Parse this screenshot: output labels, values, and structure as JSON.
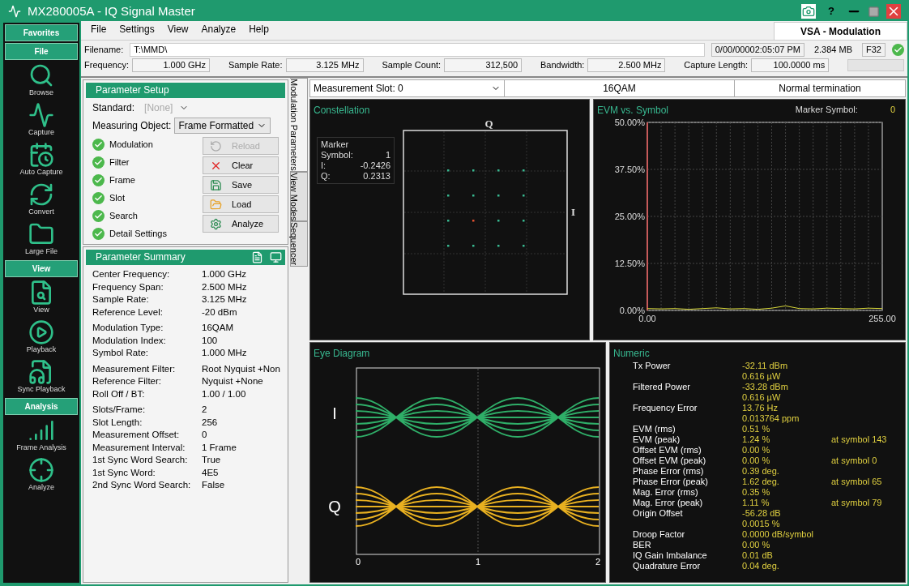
{
  "window": {
    "title": "MX280005A - IQ Signal Master",
    "help_button": "?"
  },
  "sidebar": {
    "sections": [
      {
        "header": "Favorites"
      },
      {
        "header": "File",
        "items": [
          "Browse",
          "Capture",
          "Auto Capture",
          "Convert",
          "Large File"
        ]
      },
      {
        "header": "View",
        "items": [
          "View",
          "Playback",
          "Sync Playback"
        ]
      },
      {
        "header": "Analysis",
        "items": [
          "Frame Analysis",
          "Analyze"
        ]
      }
    ]
  },
  "menu": [
    "File",
    "Settings",
    "View",
    "Analyze",
    "Help"
  ],
  "mode_tab": "VSA - Modulation",
  "info": {
    "filename_label": "Filename:",
    "filename": "T:\\MMD\\",
    "timestamp": "0/00/00002:05:07 PM",
    "size": "2.384 MB",
    "format": "F32",
    "fields": [
      {
        "label": "Frequency:",
        "value": "1.000 GHz"
      },
      {
        "label": "Sample Rate:",
        "value": "3.125 MHz"
      },
      {
        "label": "Sample Count:",
        "value": "312,500"
      },
      {
        "label": "Bandwidth:",
        "value": "2.500 MHz"
      },
      {
        "label": "Capture Length:",
        "value": "100.0000 ms"
      }
    ]
  },
  "parameter_setup": {
    "title": "Parameter Setup",
    "standard_label": "Standard:",
    "standard_value": "[None]",
    "standard_disabled": true,
    "object_label": "Measuring Object:",
    "object_value": "Frame Formatted",
    "checklist": [
      {
        "label": "Modulation",
        "checked": true
      },
      {
        "label": "Filter",
        "checked": true
      },
      {
        "label": "Frame",
        "checked": true
      },
      {
        "label": "Slot",
        "checked": true
      },
      {
        "label": "Search",
        "checked": true
      },
      {
        "label": "Detail Settings",
        "checked": true
      }
    ],
    "buttons": [
      {
        "label": "Reload",
        "disabled": true
      },
      {
        "label": "Clear",
        "disabled": false
      },
      {
        "label": "Save",
        "disabled": false
      },
      {
        "label": "Load",
        "disabled": false
      },
      {
        "label": "Analyze",
        "disabled": false
      }
    ]
  },
  "parameter_summary": {
    "title": "Parameter Summary",
    "groups": [
      [
        {
          "label": "Center Frequency:",
          "value": "1.000 GHz"
        },
        {
          "label": "Frequency Span:",
          "value": "2.500 MHz"
        },
        {
          "label": "Sample Rate:",
          "value": "3.125 MHz"
        },
        {
          "label": "Reference Level:",
          "value": "-20 dBm"
        }
      ],
      [
        {
          "label": "Modulation Type:",
          "value": "16QAM"
        },
        {
          "label": "Modulation Index:",
          "value": "100"
        },
        {
          "label": "Symbol Rate:",
          "value": "1.000 MHz"
        }
      ],
      [
        {
          "label": "Measurement Filter:",
          "value": "Root Nyquist +Non"
        },
        {
          "label": "Reference Filter:",
          "value": "Nyquist +None"
        },
        {
          "label": "Roll Off / BT:",
          "value": "1.00 / 1.00"
        }
      ],
      [
        {
          "label": "Slots/Frame:",
          "value": "2"
        },
        {
          "label": "Slot Length:",
          "value": "256"
        },
        {
          "label": "Measurement Offset:",
          "value": "0"
        },
        {
          "label": "Measurement Interval:",
          "value": "1 Frame"
        },
        {
          "label": "1st Sync Word Search:",
          "value": "True"
        },
        {
          "label": "1st Sync Word:",
          "value": "4E5"
        },
        {
          "label": "2nd Sync Word Search:",
          "value": "False"
        }
      ]
    ]
  },
  "side_tabs": [
    {
      "label": "Modulation Parameters",
      "selected": true
    },
    {
      "label": "View Modes",
      "selected": false
    },
    {
      "label": "Sequencer",
      "selected": false
    }
  ],
  "status_strip": {
    "slot": "Measurement Slot: 0",
    "modulation": "16QAM",
    "result": "Normal termination"
  },
  "constellation": {
    "title": "Constellation",
    "marker_title": "Marker",
    "marker_rows": [
      {
        "label": "Symbol:",
        "value": "1"
      },
      {
        "label": "I:",
        "value": "-0.2426"
      },
      {
        "label": "Q:",
        "value": "0.2313"
      }
    ],
    "q_label": "Q",
    "i_label": "I"
  },
  "evm": {
    "title": "EVM vs. Symbol",
    "marker_label": "Marker Symbol:",
    "marker_value": "0",
    "chart_data": {
      "type": "line",
      "grid": true,
      "xlim": [
        0,
        255
      ],
      "ylim": [
        0,
        50
      ],
      "xticks": [
        {
          "value": 0,
          "label": "0.00"
        },
        {
          "value": 255,
          "label": "255.00"
        }
      ],
      "yticks": [
        {
          "value": 0,
          "label": "0.00%"
        },
        {
          "value": 12.5,
          "label": "12.50%"
        },
        {
          "value": 25,
          "label": "25.00%"
        },
        {
          "value": 37.5,
          "label": "37.50%"
        },
        {
          "value": 50,
          "label": "50.00%"
        }
      ],
      "x": [
        0,
        15,
        30,
        45,
        60,
        75,
        90,
        105,
        120,
        135,
        150,
        165,
        180,
        195,
        210,
        225,
        240,
        255
      ],
      "series": [
        {
          "color": "#d8d83a",
          "values": [
            0.5,
            0.4,
            0.5,
            0.3,
            0.5,
            0.7,
            0.4,
            0.5,
            0.3,
            0.6,
            1.2,
            0.5,
            0.4,
            0.6,
            0.5,
            0.4,
            0.6,
            0.5
          ]
        }
      ]
    }
  },
  "eye": {
    "title": "Eye Diagram",
    "i_label": "I",
    "q_label": "Q",
    "x_labels": [
      "0",
      "1",
      "2"
    ]
  },
  "numeric": {
    "title": "Numeric",
    "rows": [
      {
        "label": "Tx Power",
        "value": "-32.11 dBm"
      },
      {
        "label": "",
        "value": "0.616 µW"
      },
      {
        "label": "Filtered Power",
        "value": "-33.28 dBm"
      },
      {
        "label": "",
        "value": "0.616 µW"
      },
      {
        "label": "Frequency Error",
        "value": "13.76 Hz"
      },
      {
        "label": "",
        "value": "0.013764 ppm"
      },
      {
        "label": "EVM (rms)",
        "value": "0.51 %"
      },
      {
        "label": "EVM (peak)",
        "value": "1.24 %",
        "note": "at symbol 143"
      },
      {
        "label": "Offset EVM (rms)",
        "value": "0.00 %"
      },
      {
        "label": "Offset EVM (peak)",
        "value": "0.00 %",
        "note": "at symbol 0"
      },
      {
        "label": "Phase Error (rms)",
        "value": "0.39 deg."
      },
      {
        "label": "Phase Error (peak)",
        "value": "1.62 deg.",
        "note": "at symbol 65"
      },
      {
        "label": "Mag. Error (rms)",
        "value": "0.35 %"
      },
      {
        "label": "Mag. Error (peak)",
        "value": "1.11 %",
        "note": "at symbol 79"
      },
      {
        "label": "Origin Offset",
        "value": "-56.28 dB"
      },
      {
        "label": "",
        "value": "0.0015 %"
      },
      {
        "label": "Droop Factor",
        "value": "0.0000 dB/symbol"
      },
      {
        "label": "BER",
        "value": "0.00 %"
      },
      {
        "label": "IQ Gain Imbalance",
        "value": "0.01 dB"
      },
      {
        "label": "Quadrature Error",
        "value": "0.04 deg."
      }
    ]
  }
}
